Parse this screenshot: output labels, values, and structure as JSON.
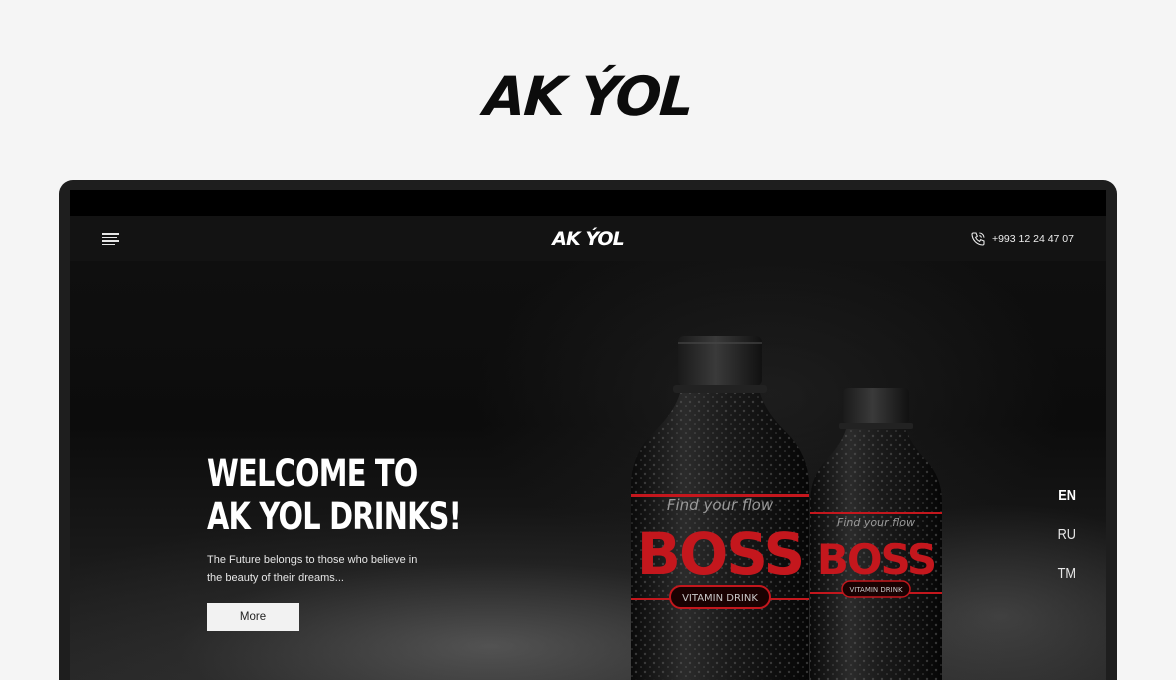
{
  "brand": {
    "name": "AK ÝOL"
  },
  "nav": {
    "logo": "AK ÝOL",
    "phone": "+993 12 24 47 07"
  },
  "hero": {
    "title_line1": "WELCOME TO",
    "title_line2": "AK YOL DRINKS!",
    "subtitle_line1": "The Future belongs to those who believe in",
    "subtitle_line2": "the beauty of their dreams...",
    "button": "More"
  },
  "languages": [
    {
      "code": "EN",
      "active": true
    },
    {
      "code": "RU",
      "active": false
    },
    {
      "code": "TM",
      "active": false
    }
  ],
  "product": {
    "tagline": "Find your flow",
    "name": "BOSS",
    "type": "VITAMIN DRINK"
  },
  "colors": {
    "accent_red": "#c4171d",
    "background": "#f5f5f5",
    "hero_dark": "#0c0c0c"
  }
}
